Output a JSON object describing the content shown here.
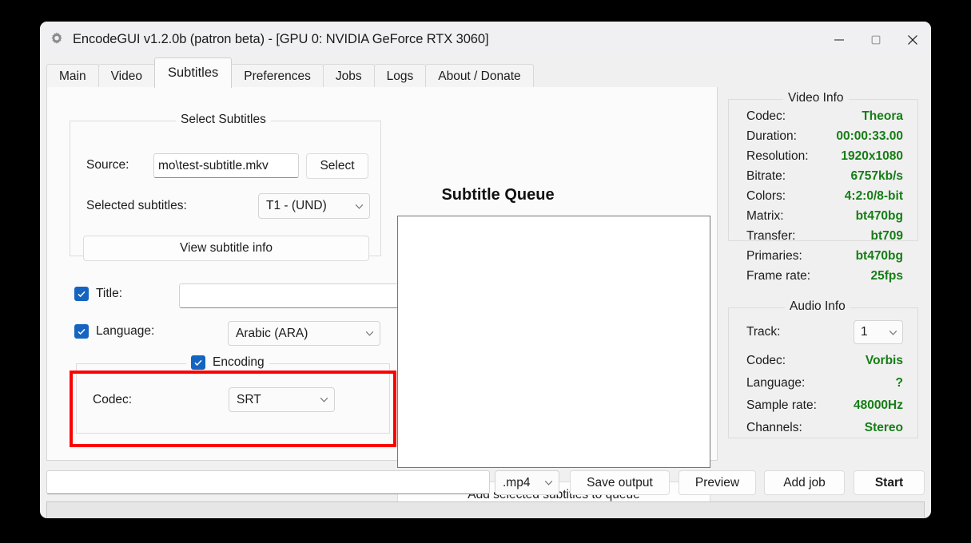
{
  "window": {
    "title": "EncodeGUI v1.2.0b (patron beta) - [GPU 0: NVIDIA GeForce RTX 3060]",
    "app_icon": "gear-icon",
    "controls": {
      "minimize": "minimize-icon",
      "maximize": "maximize-icon",
      "close": "close-icon"
    }
  },
  "tabs": [
    {
      "label": "Main",
      "active": false
    },
    {
      "label": "Video",
      "active": false
    },
    {
      "label": "Subtitles",
      "active": true
    },
    {
      "label": "Preferences",
      "active": false
    },
    {
      "label": "Jobs",
      "active": false
    },
    {
      "label": "Logs",
      "active": false
    },
    {
      "label": "About / Donate",
      "active": false
    }
  ],
  "subtitles_tab": {
    "select_subtitles_group": {
      "title": "Select Subtitles",
      "source_label": "Source:",
      "source_value": "mo\\test-subtitle.mkv",
      "select_button": "Select",
      "selected_subtitles_label": "Selected subtitles:",
      "selected_subtitles_value": "T1 - (UND)",
      "view_info_button": "View subtitle info"
    },
    "title_row": {
      "label": "Title:",
      "checked": true,
      "value": "",
      "placeholder": ""
    },
    "language_row": {
      "label": "Language:",
      "checked": true,
      "value": "Arabic (ARA)"
    },
    "encoding_group": {
      "title": "Encoding",
      "checked": true,
      "codec_label": "Codec:",
      "codec_value": "SRT",
      "highlighted": true,
      "highlight_color": "#fe0000"
    },
    "queue": {
      "title": "Subtitle Queue",
      "items": [],
      "add_button": "Add selected subtitles to queue"
    }
  },
  "video_info": {
    "title": "Video Info",
    "value_color": "#167d16",
    "rows": [
      {
        "key": "Codec:",
        "value": "Theora"
      },
      {
        "key": "Duration:",
        "value": "00:00:33.00"
      },
      {
        "key": "Resolution:",
        "value": "1920x1080"
      },
      {
        "key": "Bitrate:",
        "value": "6757kb/s"
      },
      {
        "key": "Colors:",
        "value": "4:2:0/8-bit"
      },
      {
        "key": "Matrix:",
        "value": "bt470bg"
      },
      {
        "key": "Transfer:",
        "value": "bt709"
      },
      {
        "key": "Primaries:",
        "value": "bt470bg"
      },
      {
        "key": "Frame rate:",
        "value": "25fps"
      }
    ]
  },
  "audio_info": {
    "title": "Audio Info",
    "track_label": "Track:",
    "track_value": "1",
    "rows": [
      {
        "key": "Codec:",
        "value": "Vorbis"
      },
      {
        "key": "Language:",
        "value": "?"
      },
      {
        "key": "Sample rate:",
        "value": "48000Hz"
      },
      {
        "key": "Channels:",
        "value": "Stereo"
      }
    ]
  },
  "bottom_bar": {
    "output_path_value": "",
    "output_path_placeholder": "",
    "container_value": ".mp4",
    "save_output_button": "Save output",
    "preview_button": "Preview",
    "add_job_button": "Add job",
    "start_button": "Start",
    "status_text": ""
  }
}
